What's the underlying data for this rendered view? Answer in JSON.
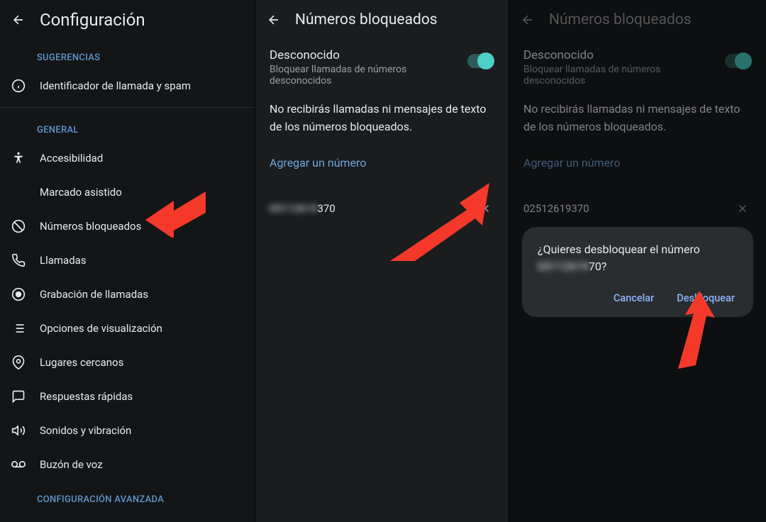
{
  "pane1": {
    "title": "Configuración",
    "section_suggestions": "SUGERENCIAS",
    "item_caller_id": "Identificador de llamada y spam",
    "section_general": "GENERAL",
    "item_accessibility": "Accesibilidad",
    "item_assisted_dial": "Marcado asistido",
    "item_blocked_numbers": "Números bloqueados",
    "item_calls": "Llamadas",
    "item_recording": "Grabación de llamadas",
    "item_display": "Opciones de visualización",
    "item_nearby": "Lugares cercanos",
    "item_quick_responses": "Respuestas rápidas",
    "item_sounds": "Sonidos y vibración",
    "item_voicemail": "Buzón de voz",
    "section_advanced": "CONFIGURACIÓN AVANZADA"
  },
  "pane2": {
    "title": "Números bloqueados",
    "unknown_title": "Desconocido",
    "unknown_sub": "Bloquear llamadas de números desconocidos",
    "info": "No recibirás llamadas ni mensajes de texto de los números bloqueados.",
    "add_link": "Agregar un número",
    "blocked_number_suffix": "370",
    "blocked_number_full": "05112619370"
  },
  "pane3": {
    "title": "Números bloqueados",
    "unknown_title": "Desconocido",
    "unknown_sub": "Bloquear llamadas de números desconocidos",
    "info": "No recibirás llamadas ni mensajes de texto de los números bloqueados.",
    "add_link": "Agregar un número",
    "blocked_number": "02512619370",
    "dialog_line1": "¿Quieres desbloquear el número",
    "dialog_num_blur": "05112619",
    "dialog_num_end": "70?",
    "dialog_cancel": "Cancelar",
    "dialog_confirm": "Desbloquear"
  }
}
